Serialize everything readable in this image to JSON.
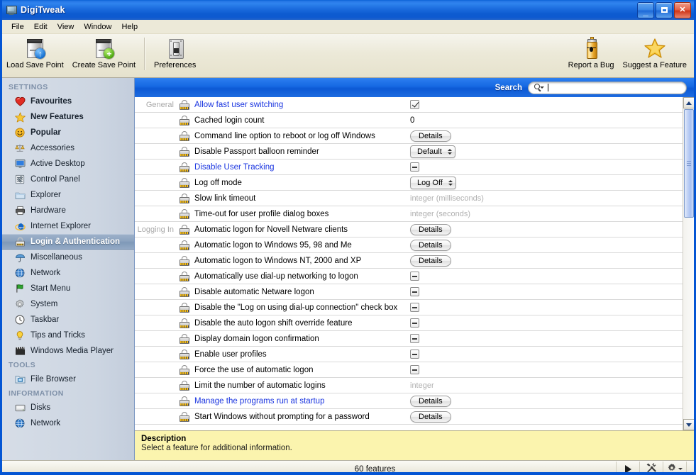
{
  "window": {
    "title": "DigiTweak",
    "icon": "computer-icon",
    "buttons": {
      "minimize": "_",
      "maximize": "□",
      "close": "✕"
    }
  },
  "menubar": {
    "items": [
      "File",
      "Edit",
      "View",
      "Window",
      "Help"
    ]
  },
  "toolbar": {
    "left": [
      {
        "label": "Load Save Point",
        "icon": "load-save-point-icon"
      },
      {
        "label": "Create Save Point",
        "icon": "create-save-point-icon"
      },
      {
        "label": "Preferences",
        "icon": "preferences-icon"
      }
    ],
    "right": [
      {
        "label": "Report a Bug",
        "icon": "bug-spray-icon"
      },
      {
        "label": "Suggest a Feature",
        "icon": "star-icon"
      }
    ]
  },
  "sidebar": {
    "groups": [
      {
        "title": "SETTINGS",
        "items": [
          {
            "label": "Favourites",
            "icon": "heart-icon",
            "bold": true,
            "selected": false
          },
          {
            "label": "New Features",
            "icon": "star-icon",
            "bold": true,
            "selected": false
          },
          {
            "label": "Popular",
            "icon": "smiley-icon",
            "bold": true,
            "selected": false
          },
          {
            "label": "Accessories",
            "icon": "scales-icon",
            "bold": false,
            "selected": false
          },
          {
            "label": "Active Desktop",
            "icon": "monitor-icon",
            "bold": false,
            "selected": false
          },
          {
            "label": "Control Panel",
            "icon": "sliders-icon",
            "bold": false,
            "selected": false
          },
          {
            "label": "Explorer",
            "icon": "folder-icon",
            "bold": false,
            "selected": false
          },
          {
            "label": "Hardware",
            "icon": "printer-icon",
            "bold": false,
            "selected": false
          },
          {
            "label": "Internet Explorer",
            "icon": "internet-explorer-icon",
            "bold": false,
            "selected": false
          },
          {
            "label": "Login & Authentication",
            "icon": "padlock-icon",
            "bold": true,
            "selected": true
          },
          {
            "label": "Miscellaneous",
            "icon": "umbrella-icon",
            "bold": false,
            "selected": false
          },
          {
            "label": "Network",
            "icon": "globe-icon",
            "bold": false,
            "selected": false
          },
          {
            "label": "Start Menu",
            "icon": "flag-icon",
            "bold": false,
            "selected": false
          },
          {
            "label": "System",
            "icon": "gear-icon",
            "bold": false,
            "selected": false
          },
          {
            "label": "Taskbar",
            "icon": "clock-icon",
            "bold": false,
            "selected": false
          },
          {
            "label": "Tips and Tricks",
            "icon": "lightbulb-icon",
            "bold": false,
            "selected": false
          },
          {
            "label": "Windows Media Player",
            "icon": "clapperboard-icon",
            "bold": false,
            "selected": false
          }
        ]
      },
      {
        "title": "TOOLS",
        "items": [
          {
            "label": "File Browser",
            "icon": "file-browser-icon",
            "bold": false,
            "selected": false
          }
        ]
      },
      {
        "title": "INFORMATION",
        "items": [
          {
            "label": "Disks",
            "icon": "disk-icon",
            "bold": false,
            "selected": false
          },
          {
            "label": "Network",
            "icon": "globe-icon",
            "bold": false,
            "selected": false
          }
        ]
      }
    ]
  },
  "search": {
    "label": "Search",
    "value": "",
    "placeholder": "",
    "icon": "search-icon"
  },
  "feature_list": {
    "rows": [
      {
        "category": "General",
        "name": "Allow fast user switching",
        "link": true,
        "control": {
          "type": "checkbox",
          "state": "checked"
        }
      },
      {
        "category": "",
        "name": "Cached login count",
        "link": false,
        "control": {
          "type": "text",
          "value": "0"
        }
      },
      {
        "category": "",
        "name": "Command line option to reboot or log off Windows",
        "link": false,
        "control": {
          "type": "button",
          "label": "Details"
        }
      },
      {
        "category": "",
        "name": "Disable Passport balloon reminder",
        "link": false,
        "control": {
          "type": "popup",
          "value": "Default"
        }
      },
      {
        "category": "",
        "name": "Disable User Tracking",
        "link": true,
        "control": {
          "type": "checkbox",
          "state": "mixed"
        }
      },
      {
        "category": "",
        "name": "Log off mode",
        "link": false,
        "control": {
          "type": "popup",
          "value": "Log Off"
        }
      },
      {
        "category": "",
        "name": "Slow link timeout",
        "link": false,
        "control": {
          "type": "hint",
          "value": "integer (milliseconds)"
        }
      },
      {
        "category": "",
        "name": "Time-out for user profile dialog boxes",
        "link": false,
        "control": {
          "type": "hint",
          "value": "integer (seconds)"
        }
      },
      {
        "category": "Logging In",
        "name": "Automatic logon for Novell Netware clients",
        "link": false,
        "control": {
          "type": "button",
          "label": "Details"
        }
      },
      {
        "category": "",
        "name": "Automatic logon to Windows 95, 98 and Me",
        "link": false,
        "control": {
          "type": "button",
          "label": "Details"
        }
      },
      {
        "category": "",
        "name": "Automatic logon to Windows NT, 2000 and XP",
        "link": false,
        "control": {
          "type": "button",
          "label": "Details"
        }
      },
      {
        "category": "",
        "name": "Automatically use dial-up networking to logon",
        "link": false,
        "control": {
          "type": "checkbox",
          "state": "mixed"
        }
      },
      {
        "category": "",
        "name": "Disable automatic Netware logon",
        "link": false,
        "control": {
          "type": "checkbox",
          "state": "mixed"
        }
      },
      {
        "category": "",
        "name": "Disable the \"Log on using dial-up connection\" check box",
        "link": false,
        "control": {
          "type": "checkbox",
          "state": "mixed"
        }
      },
      {
        "category": "",
        "name": "Disable the auto logon shift override feature",
        "link": false,
        "control": {
          "type": "checkbox",
          "state": "mixed"
        }
      },
      {
        "category": "",
        "name": "Display domain logon confirmation",
        "link": false,
        "control": {
          "type": "checkbox",
          "state": "mixed"
        }
      },
      {
        "category": "",
        "name": "Enable user profiles",
        "link": false,
        "control": {
          "type": "checkbox",
          "state": "mixed"
        }
      },
      {
        "category": "",
        "name": "Force the use of automatic logon",
        "link": false,
        "control": {
          "type": "checkbox",
          "state": "mixed"
        }
      },
      {
        "category": "",
        "name": "Limit the number of automatic logins",
        "link": false,
        "control": {
          "type": "hint",
          "value": "integer"
        }
      },
      {
        "category": "",
        "name": "Manage the programs run at startup",
        "link": true,
        "control": {
          "type": "button",
          "label": "Details"
        }
      },
      {
        "category": "",
        "name": "Start Windows without prompting for a password",
        "link": false,
        "control": {
          "type": "button",
          "label": "Details"
        }
      }
    ]
  },
  "description": {
    "title": "Description",
    "body": "Select a feature for additional information."
  },
  "statusbar": {
    "count": "60 features",
    "buttons": [
      {
        "icon": "play-icon"
      },
      {
        "icon": "tools-icon"
      },
      {
        "icon": "gear-dropdown-icon"
      }
    ]
  },
  "colors": {
    "titlebar_blue": "#0c59d4",
    "accent_link": "#1a35e0",
    "sidebar_bg": "#cdd6e2",
    "description_bg": "#fbf4ae",
    "selected_item": "#8ba3bf"
  }
}
